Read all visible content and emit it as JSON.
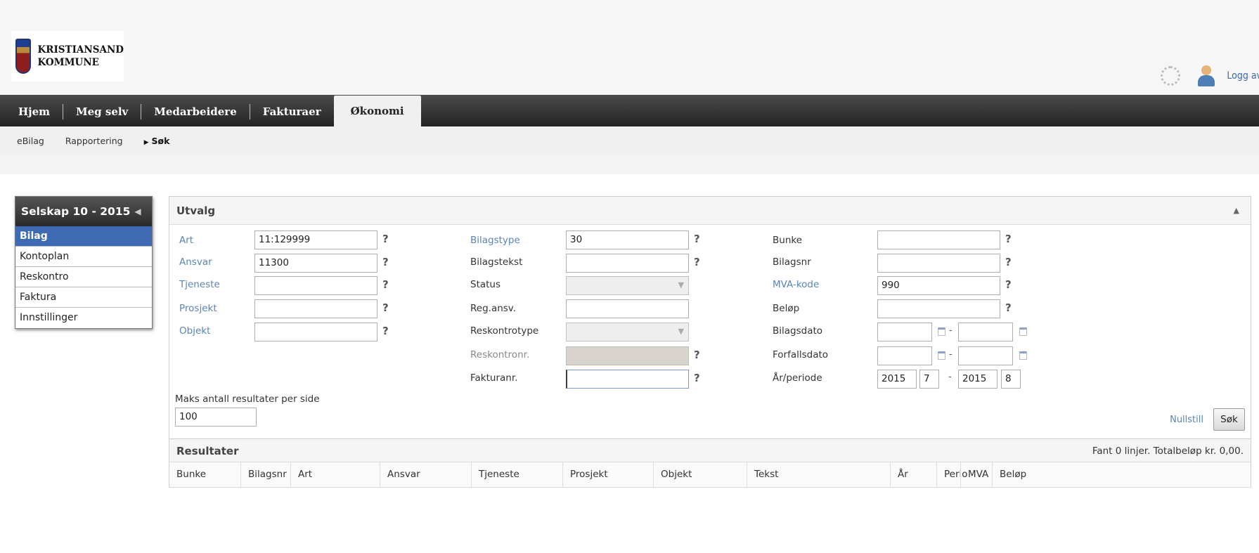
{
  "header": {
    "org_line1": "KRISTIANSAND",
    "org_line2": "KOMMUNE",
    "logout_label": "Logg av"
  },
  "main_nav": {
    "items": [
      "Hjem",
      "Meg selv",
      "Medarbeidere",
      "Fakturaer",
      "Økonomi"
    ],
    "active": "Økonomi"
  },
  "sub_nav": {
    "items": [
      "eBilag",
      "Rapportering",
      "Søk"
    ],
    "active": "Søk"
  },
  "left_menu": {
    "title": "Selskap 10 - 2015",
    "items": [
      "Bilag",
      "Kontoplan",
      "Reskontro",
      "Faktura",
      "Innstillinger"
    ],
    "active": "Bilag"
  },
  "utvalg": {
    "title": "Utvalg",
    "col1": [
      {
        "label": "Art",
        "value": "11:129999"
      },
      {
        "label": "Ansvar",
        "value": "11300"
      },
      {
        "label": "Tjeneste",
        "value": ""
      },
      {
        "label": "Prosjekt",
        "value": ""
      },
      {
        "label": "Objekt",
        "value": ""
      }
    ],
    "col2": [
      {
        "label": "Bilagstype",
        "value": "30"
      },
      {
        "label": "Bilagstekst",
        "value": ""
      },
      {
        "label": "Status",
        "value": ""
      },
      {
        "label": "Reg.ansv.",
        "value": ""
      },
      {
        "label": "Reskontrotype",
        "value": ""
      },
      {
        "label": "Reskontronr.",
        "value": ""
      },
      {
        "label": "Fakturanr.",
        "value": ""
      }
    ],
    "col3": [
      {
        "label": "Bunke",
        "value": ""
      },
      {
        "label": "Bilagsnr",
        "value": ""
      },
      {
        "label": "MVA-kode",
        "value": "990"
      },
      {
        "label": "Beløp",
        "value": ""
      },
      {
        "label": "Bilagsdato",
        "from": "",
        "to": ""
      },
      {
        "label": "Forfallsdato",
        "from": "",
        "to": ""
      },
      {
        "label": "År/periode",
        "year_from": "2015",
        "period_from": "7",
        "year_to": "2015",
        "period_to": "8"
      }
    ],
    "help_glyph": "?",
    "range_separator": "-",
    "max_results_label": "Maks antall resultater per side",
    "max_results_value": "100",
    "reset_label": "Nullstill",
    "search_label": "Søk"
  },
  "results": {
    "title": "Resultater",
    "summary": "Fant 0 linjer. Totalbeløp kr. 0,00.",
    "columns": [
      "Bunke",
      "Bilagsnr",
      "Art",
      "Ansvar",
      "Tjeneste",
      "Prosjekt",
      "Objekt",
      "Tekst",
      "År",
      "Perio",
      "MVA",
      "Beløp"
    ]
  },
  "icons": {
    "settings": "gear-icon",
    "user": "user-icon",
    "calendar": "calendar-icon",
    "dropdown": "chevron-down-icon",
    "collapse": "chevron-up-icon"
  },
  "colors": {
    "nav_dark": "#2e2e2e",
    "active_menu": "#3d6ab3",
    "link": "#5a84b5"
  }
}
